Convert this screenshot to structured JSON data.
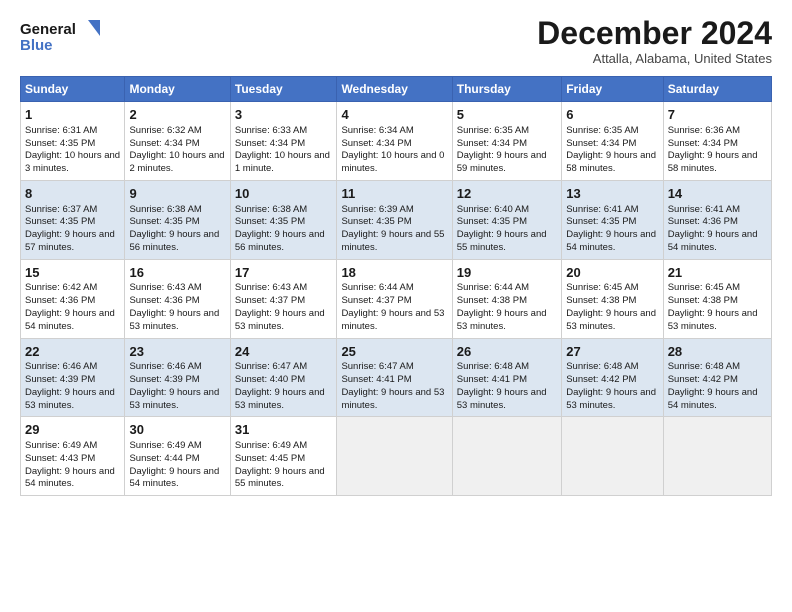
{
  "logo": {
    "line1": "General",
    "line2": "Blue"
  },
  "title": "December 2024",
  "location": "Attalla, Alabama, United States",
  "headers": [
    "Sunday",
    "Monday",
    "Tuesday",
    "Wednesday",
    "Thursday",
    "Friday",
    "Saturday"
  ],
  "weeks": [
    [
      {
        "day": "1",
        "sunrise": "Sunrise: 6:31 AM",
        "sunset": "Sunset: 4:35 PM",
        "daylight": "Daylight: 10 hours and 3 minutes."
      },
      {
        "day": "2",
        "sunrise": "Sunrise: 6:32 AM",
        "sunset": "Sunset: 4:34 PM",
        "daylight": "Daylight: 10 hours and 2 minutes."
      },
      {
        "day": "3",
        "sunrise": "Sunrise: 6:33 AM",
        "sunset": "Sunset: 4:34 PM",
        "daylight": "Daylight: 10 hours and 1 minute."
      },
      {
        "day": "4",
        "sunrise": "Sunrise: 6:34 AM",
        "sunset": "Sunset: 4:34 PM",
        "daylight": "Daylight: 10 hours and 0 minutes."
      },
      {
        "day": "5",
        "sunrise": "Sunrise: 6:35 AM",
        "sunset": "Sunset: 4:34 PM",
        "daylight": "Daylight: 9 hours and 59 minutes."
      },
      {
        "day": "6",
        "sunrise": "Sunrise: 6:35 AM",
        "sunset": "Sunset: 4:34 PM",
        "daylight": "Daylight: 9 hours and 58 minutes."
      },
      {
        "day": "7",
        "sunrise": "Sunrise: 6:36 AM",
        "sunset": "Sunset: 4:34 PM",
        "daylight": "Daylight: 9 hours and 58 minutes."
      }
    ],
    [
      {
        "day": "8",
        "sunrise": "Sunrise: 6:37 AM",
        "sunset": "Sunset: 4:35 PM",
        "daylight": "Daylight: 9 hours and 57 minutes."
      },
      {
        "day": "9",
        "sunrise": "Sunrise: 6:38 AM",
        "sunset": "Sunset: 4:35 PM",
        "daylight": "Daylight: 9 hours and 56 minutes."
      },
      {
        "day": "10",
        "sunrise": "Sunrise: 6:38 AM",
        "sunset": "Sunset: 4:35 PM",
        "daylight": "Daylight: 9 hours and 56 minutes."
      },
      {
        "day": "11",
        "sunrise": "Sunrise: 6:39 AM",
        "sunset": "Sunset: 4:35 PM",
        "daylight": "Daylight: 9 hours and 55 minutes."
      },
      {
        "day": "12",
        "sunrise": "Sunrise: 6:40 AM",
        "sunset": "Sunset: 4:35 PM",
        "daylight": "Daylight: 9 hours and 55 minutes."
      },
      {
        "day": "13",
        "sunrise": "Sunrise: 6:41 AM",
        "sunset": "Sunset: 4:35 PM",
        "daylight": "Daylight: 9 hours and 54 minutes."
      },
      {
        "day": "14",
        "sunrise": "Sunrise: 6:41 AM",
        "sunset": "Sunset: 4:36 PM",
        "daylight": "Daylight: 9 hours and 54 minutes."
      }
    ],
    [
      {
        "day": "15",
        "sunrise": "Sunrise: 6:42 AM",
        "sunset": "Sunset: 4:36 PM",
        "daylight": "Daylight: 9 hours and 54 minutes."
      },
      {
        "day": "16",
        "sunrise": "Sunrise: 6:43 AM",
        "sunset": "Sunset: 4:36 PM",
        "daylight": "Daylight: 9 hours and 53 minutes."
      },
      {
        "day": "17",
        "sunrise": "Sunrise: 6:43 AM",
        "sunset": "Sunset: 4:37 PM",
        "daylight": "Daylight: 9 hours and 53 minutes."
      },
      {
        "day": "18",
        "sunrise": "Sunrise: 6:44 AM",
        "sunset": "Sunset: 4:37 PM",
        "daylight": "Daylight: 9 hours and 53 minutes."
      },
      {
        "day": "19",
        "sunrise": "Sunrise: 6:44 AM",
        "sunset": "Sunset: 4:38 PM",
        "daylight": "Daylight: 9 hours and 53 minutes."
      },
      {
        "day": "20",
        "sunrise": "Sunrise: 6:45 AM",
        "sunset": "Sunset: 4:38 PM",
        "daylight": "Daylight: 9 hours and 53 minutes."
      },
      {
        "day": "21",
        "sunrise": "Sunrise: 6:45 AM",
        "sunset": "Sunset: 4:38 PM",
        "daylight": "Daylight: 9 hours and 53 minutes."
      }
    ],
    [
      {
        "day": "22",
        "sunrise": "Sunrise: 6:46 AM",
        "sunset": "Sunset: 4:39 PM",
        "daylight": "Daylight: 9 hours and 53 minutes."
      },
      {
        "day": "23",
        "sunrise": "Sunrise: 6:46 AM",
        "sunset": "Sunset: 4:39 PM",
        "daylight": "Daylight: 9 hours and 53 minutes."
      },
      {
        "day": "24",
        "sunrise": "Sunrise: 6:47 AM",
        "sunset": "Sunset: 4:40 PM",
        "daylight": "Daylight: 9 hours and 53 minutes."
      },
      {
        "day": "25",
        "sunrise": "Sunrise: 6:47 AM",
        "sunset": "Sunset: 4:41 PM",
        "daylight": "Daylight: 9 hours and 53 minutes."
      },
      {
        "day": "26",
        "sunrise": "Sunrise: 6:48 AM",
        "sunset": "Sunset: 4:41 PM",
        "daylight": "Daylight: 9 hours and 53 minutes."
      },
      {
        "day": "27",
        "sunrise": "Sunrise: 6:48 AM",
        "sunset": "Sunset: 4:42 PM",
        "daylight": "Daylight: 9 hours and 53 minutes."
      },
      {
        "day": "28",
        "sunrise": "Sunrise: 6:48 AM",
        "sunset": "Sunset: 4:42 PM",
        "daylight": "Daylight: 9 hours and 54 minutes."
      }
    ],
    [
      {
        "day": "29",
        "sunrise": "Sunrise: 6:49 AM",
        "sunset": "Sunset: 4:43 PM",
        "daylight": "Daylight: 9 hours and 54 minutes."
      },
      {
        "day": "30",
        "sunrise": "Sunrise: 6:49 AM",
        "sunset": "Sunset: 4:44 PM",
        "daylight": "Daylight: 9 hours and 54 minutes."
      },
      {
        "day": "31",
        "sunrise": "Sunrise: 6:49 AM",
        "sunset": "Sunset: 4:45 PM",
        "daylight": "Daylight: 9 hours and 55 minutes."
      },
      null,
      null,
      null,
      null
    ]
  ]
}
